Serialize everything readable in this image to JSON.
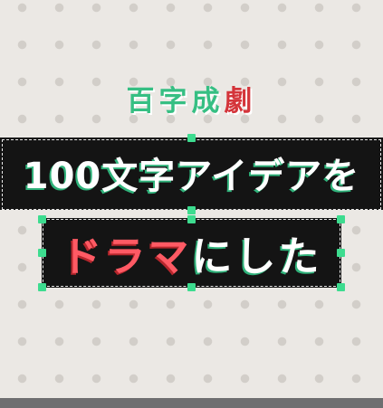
{
  "subtitle": {
    "green_part": "百字成",
    "red_part": "劇"
  },
  "headline": {
    "line1": "100文字アイデアを",
    "line2_red": "ドラマ",
    "line2_white": "にした"
  },
  "colors": {
    "background": "#ebe8e4",
    "bar": "#141414",
    "green": "#36bf83",
    "red": "#d4343a",
    "handle": "#3ddc8f"
  }
}
